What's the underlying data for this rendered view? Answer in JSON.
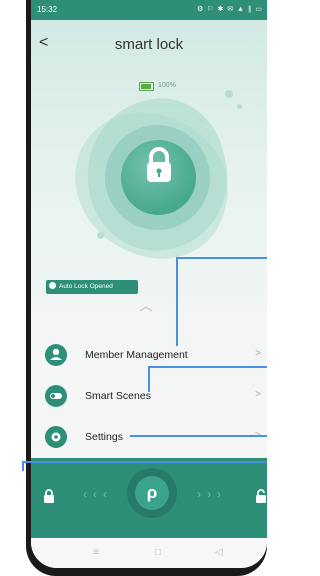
{
  "status_bar": {
    "time": "15:32",
    "icons": "⚙ ⚐ ✱ ✉ ▲ ∥ ▭"
  },
  "header": {
    "back_glyph": "<",
    "title": "smart lock",
    "more_glyph": ":"
  },
  "battery": {
    "text": "100%",
    "level": 1.0,
    "color": "#58a84a"
  },
  "status_toast": {
    "text": "Auto Lock Opened"
  },
  "menu": {
    "items": [
      {
        "label": "Member Management",
        "icon": "person-icon",
        "arrow": ">"
      },
      {
        "label": "Smart Scenes",
        "icon": "toggle-icon",
        "arrow": ">"
      },
      {
        "label": "Settings",
        "icon": "gear-icon",
        "arrow": ">"
      }
    ]
  },
  "unlock_bar": {
    "left_arrows": "‹‹‹",
    "right_arrows": "›››",
    "key_glyph": "ρ"
  },
  "navbar": {
    "menu_glyph": "≡",
    "home_glyph": "□",
    "back_glyph": "◁"
  },
  "colors": {
    "accent": "#2e8f79",
    "callout": "#4a90e2",
    "background_tint": "#cfe8e2"
  }
}
